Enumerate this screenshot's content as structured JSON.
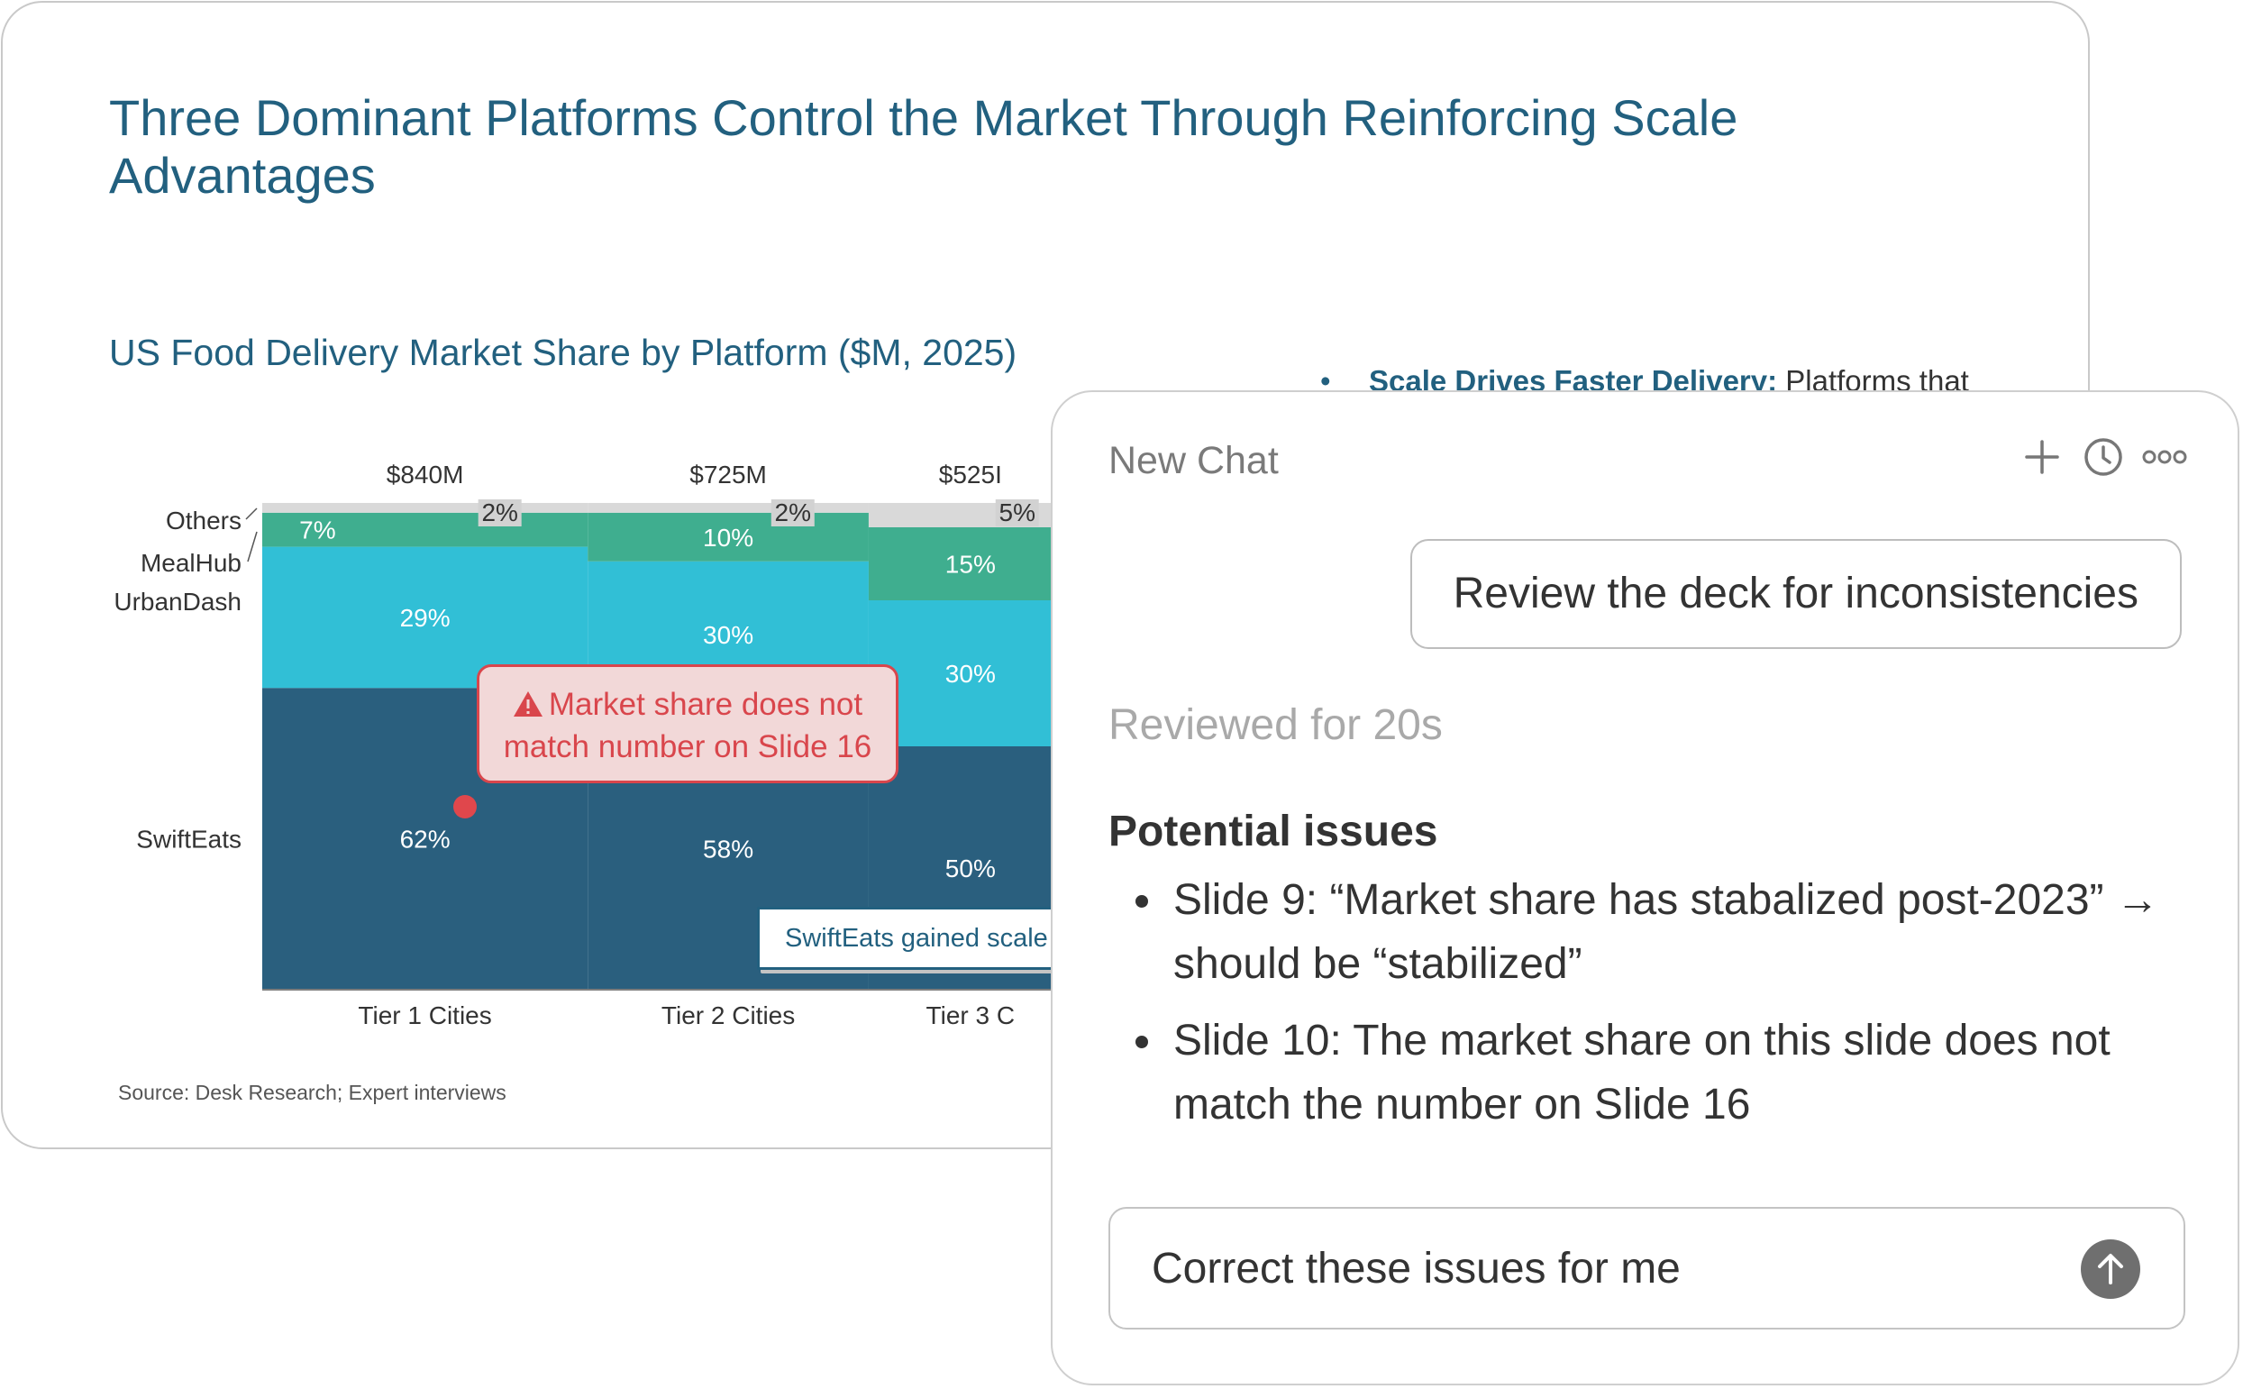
{
  "slide": {
    "title": "Three Dominant Platforms Control the Market Through Reinforcing Scale Advantages",
    "bullet": {
      "bold": "Scale Drives Faster Delivery:",
      "text": " Platforms that"
    },
    "source": "Source: Desk Research; Expert interviews",
    "callout_warning": "Market share does not match number on Slide 16",
    "callout_note": "SwiftEats gained scale",
    "colors": {
      "title": "#22607f",
      "swifteats": "#2a5f7e",
      "urbandash": "#31bfd6",
      "mealhub": "#3fae8f",
      "others": "#d9d9d9",
      "warning": "#d9464c"
    }
  },
  "chart_data": {
    "type": "bar",
    "title": "US Food Delivery Market Share by Platform ($M, 2025)",
    "stacked": true,
    "variable_width": true,
    "categories": [
      "Tier 1 Cities",
      "Tier 2 Cities",
      "Tier 3 C"
    ],
    "totals": [
      "$840M",
      "$725M",
      "$525I"
    ],
    "total_values": [
      840,
      725,
      525
    ],
    "series": [
      {
        "name": "SwiftEats",
        "values": [
          62,
          58,
          50
        ],
        "labels": [
          "62%",
          "58%",
          "50%"
        ]
      },
      {
        "name": "UrbanDash",
        "values": [
          29,
          30,
          30
        ],
        "labels": [
          "29%",
          "30%",
          "30%"
        ]
      },
      {
        "name": "MealHub",
        "values": [
          7,
          10,
          15
        ],
        "labels": [
          "7%",
          "10%",
          "15%"
        ]
      },
      {
        "name": "Others",
        "values": [
          2,
          2,
          5
        ],
        "labels": [
          "2%",
          "2%",
          "5%"
        ]
      }
    ],
    "ylim": [
      0,
      100
    ],
    "grid": false,
    "legend": "left"
  },
  "chat": {
    "title": "New Chat",
    "header_icons": [
      "plus-icon",
      "history-clock-icon",
      "more-options-icon"
    ],
    "user_message": "Review the deck for inconsistencies",
    "status": "Reviewed for 20s",
    "issues_heading": "Potential issues",
    "issues": [
      "Slide 9: “Market share has stabalized post-2023” → should be “stabilized”",
      "Slide 10: The market share on this slide does not match the number on Slide 16"
    ],
    "composer": {
      "value": "Correct these issues for me",
      "send_icon": "arrow-up-icon"
    }
  }
}
